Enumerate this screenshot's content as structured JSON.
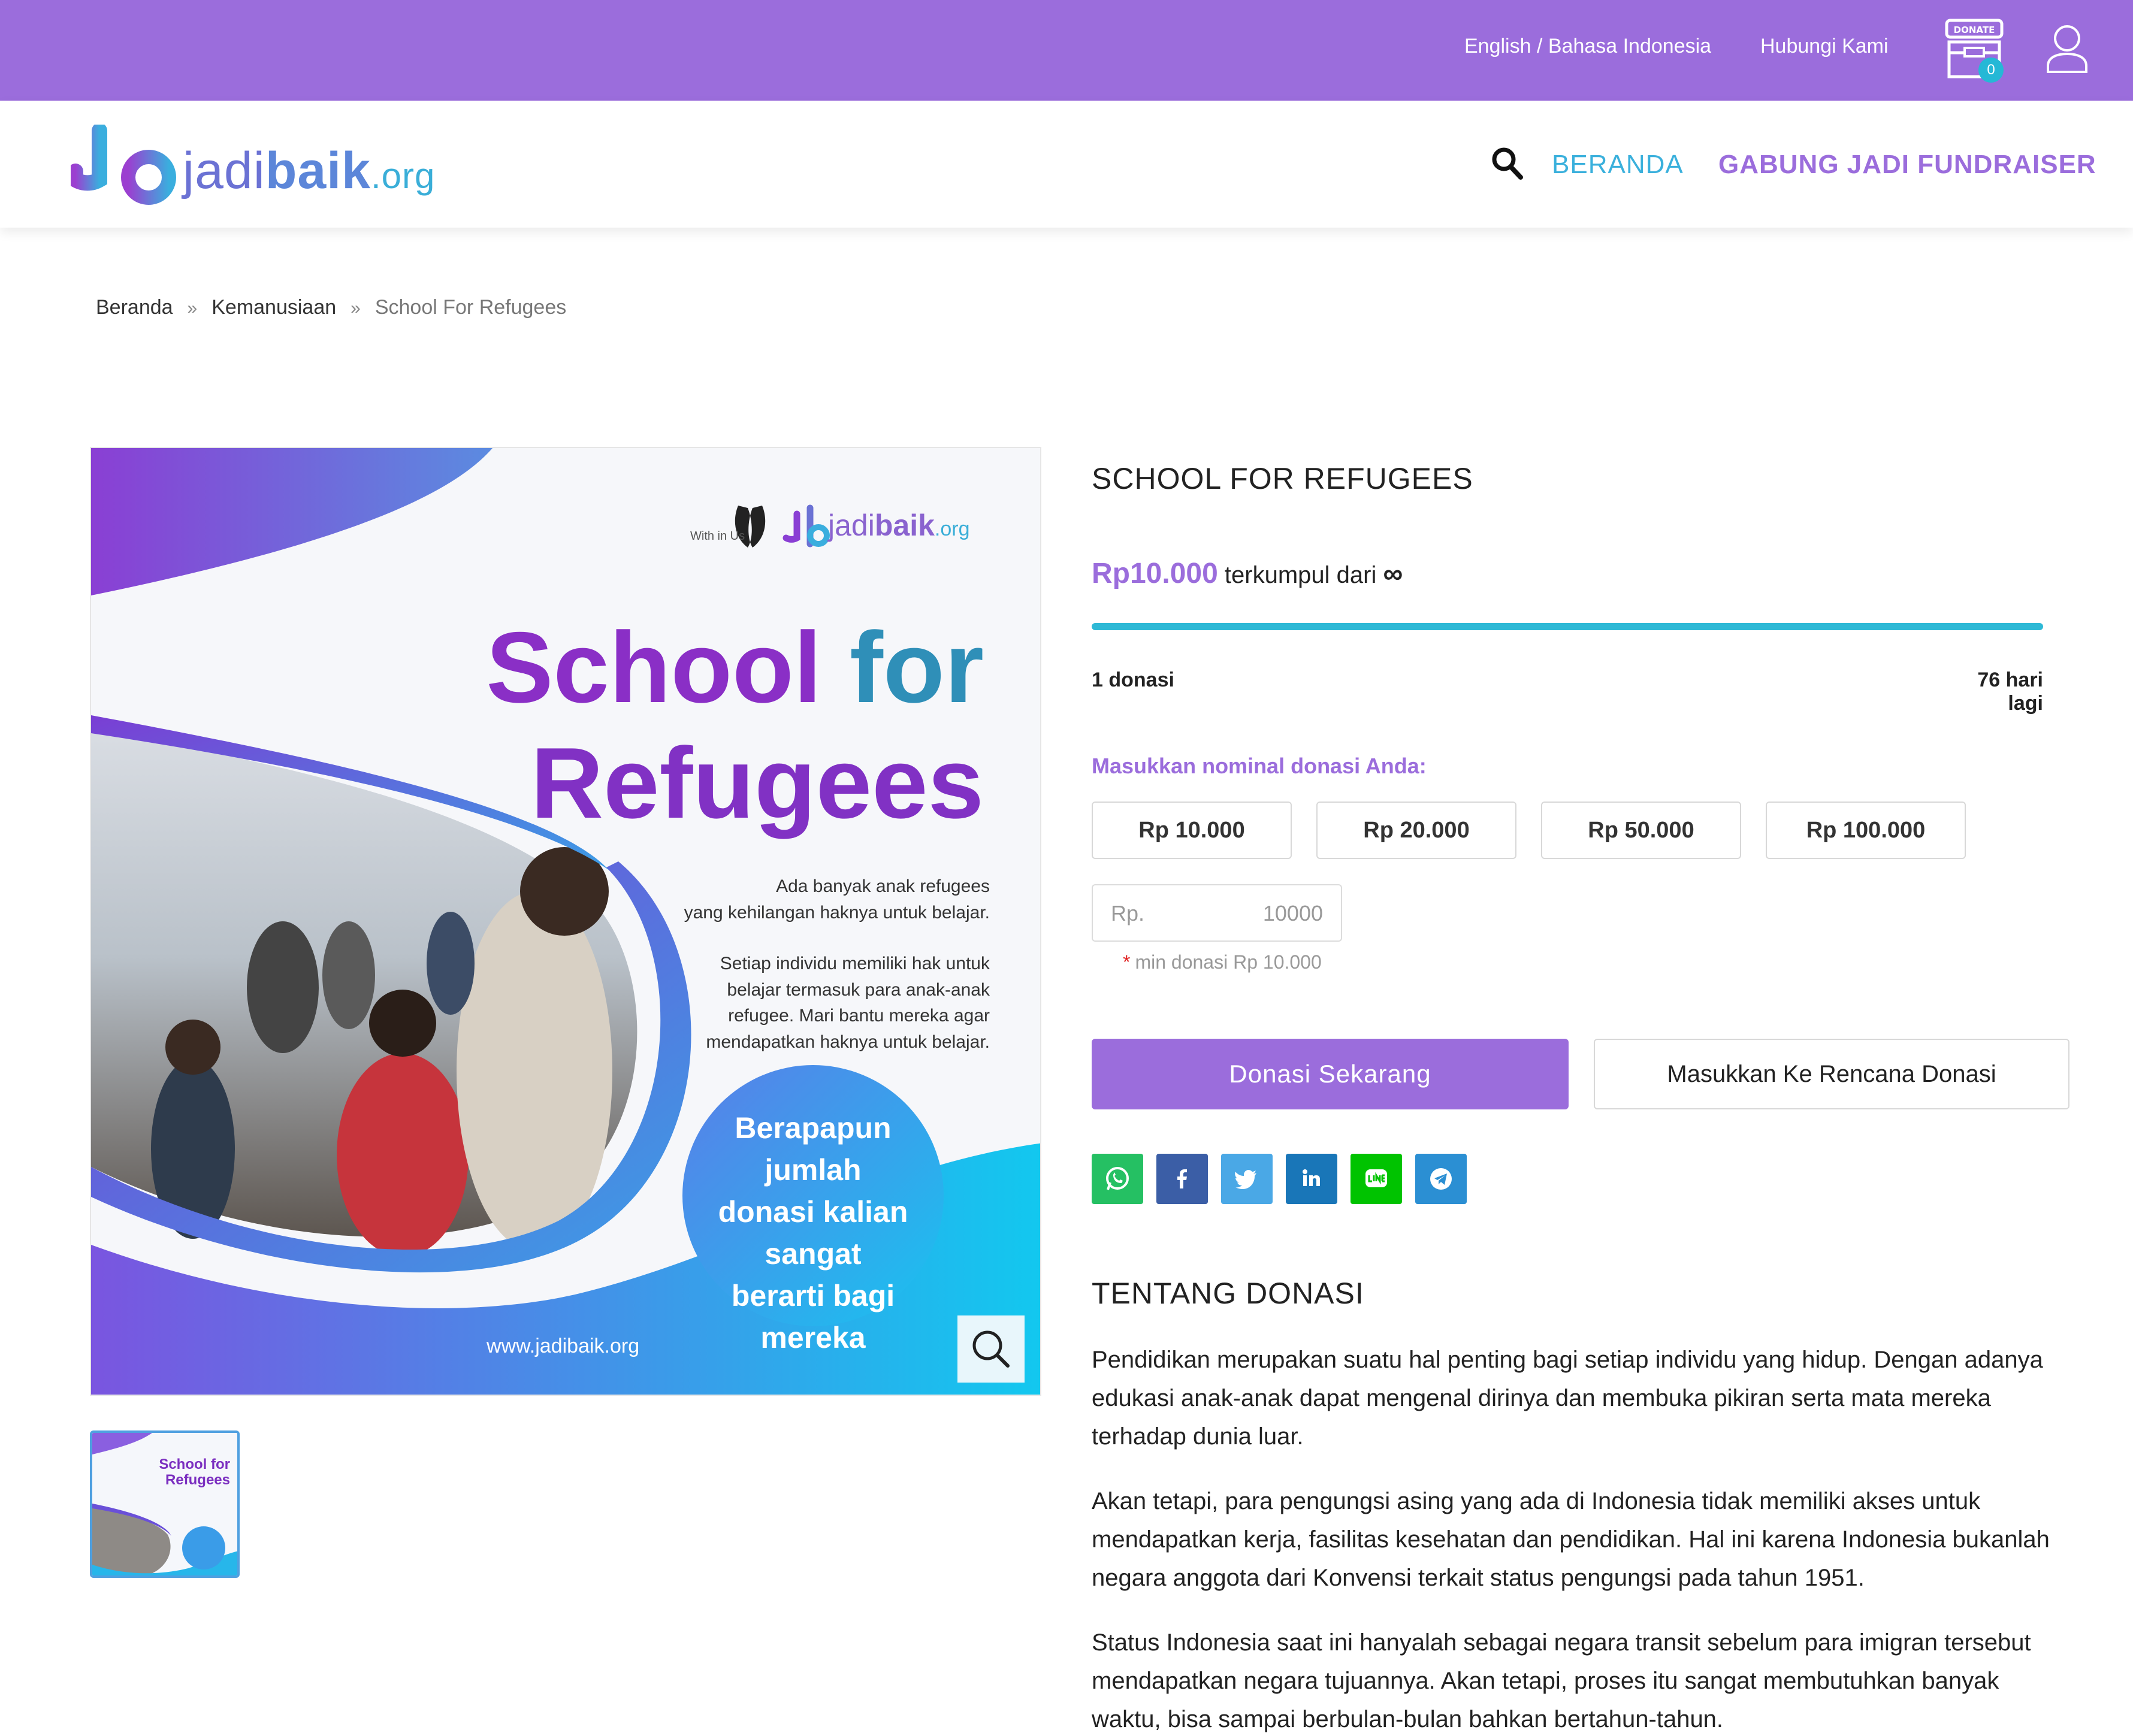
{
  "topbar": {
    "language": "English / Bahasa Indonesia",
    "contact": "Hubungi Kami",
    "donate_box_label": "DONATE",
    "cart_count": "0",
    "icons": [
      "donate-box-icon",
      "user-icon"
    ]
  },
  "header": {
    "logo_text_light": "jadi",
    "logo_text_bold": "baik",
    "logo_text_org": ".org",
    "nav_home": "BERANDA",
    "nav_fundraiser": "GABUNG JADI FUNDRAISER"
  },
  "breadcrumb": {
    "items": [
      "Beranda",
      "Kemanusiaan",
      "School For Refugees"
    ],
    "separator": "»"
  },
  "hero": {
    "title_line1_a": "School ",
    "title_line1_b": "for",
    "title_line2": "Refugees",
    "para1_line1": "Ada banyak anak refugees",
    "para1_line2": "yang kehilangan haknya untuk belajar.",
    "para2_line1": "Setiap individu memiliki hak untuk",
    "para2_line2": "belajar termasuk para anak-anak",
    "para2_line3": "refugee. Mari bantu mereka agar",
    "para2_line4": "mendapatkan haknya untuk belajar.",
    "circle_text": "Berapapun jumlah donasi kalian sangat berarti bagi mereka",
    "url": "www.jadibaik.org",
    "partner": "With in Us",
    "logo_light": "jadi",
    "logo_bold": "baik",
    "logo_org": ".org"
  },
  "thumbnail": {
    "title_line1": "School for",
    "title_line2": "Refugees"
  },
  "campaign": {
    "title": "SCHOOL FOR REFUGEES",
    "raised_amount": "Rp10.000",
    "raised_text": " terkumpul dari ",
    "target": "∞",
    "progress_percent": 100,
    "donors": "1 donasi",
    "days_left": "76 hari lagi",
    "input_label": "Masukkan nominal donasi Anda:",
    "preset_amounts": [
      "Rp 10.000",
      "Rp 20.000",
      "Rp 50.000",
      "Rp 100.000"
    ],
    "input_prefix": "Rp.",
    "input_value": "10000",
    "min_note": "min donasi Rp 10.000",
    "donate_button": "Donasi Sekarang",
    "plan_button": "Masukkan Ke Rencana Donasi"
  },
  "share": {
    "buttons": [
      {
        "name": "whatsapp",
        "color": "#25c063"
      },
      {
        "name": "facebook",
        "color": "#3b5ea6"
      },
      {
        "name": "twitter",
        "color": "#4aa8e6"
      },
      {
        "name": "linkedin",
        "color": "#1976b8"
      },
      {
        "name": "line",
        "color": "#00c300"
      },
      {
        "name": "telegram",
        "color": "#2b8fd3"
      }
    ]
  },
  "about": {
    "title": "TENTANG DONASI",
    "paragraphs": [
      "Pendidikan merupakan suatu hal penting bagi setiap individu yang hidup. Dengan adanya edukasi anak-anak dapat mengenal dirinya dan membuka pikiran serta mata mereka terhadap dunia luar.",
      "Akan tetapi, para pengungsi asing yang ada di Indonesia tidak memiliki akses untuk mendapatkan kerja, fasilitas kesehatan dan pendidikan. Hal ini karena Indonesia bukanlah negara anggota dari Konvensi terkait status pengungsi pada tahun 1951.",
      "Status Indonesia saat ini hanyalah sebagai negara transit sebelum para imigran tersebut mendapatkan negara tujuannya. Akan tetapi, proses itu sangat membutuhkan banyak waktu, bisa sampai berbulan-bulan bahkan bertahun-tahun."
    ]
  },
  "colors": {
    "brand_purple": "#9b6ddc",
    "brand_cyan": "#2eb9d6"
  }
}
